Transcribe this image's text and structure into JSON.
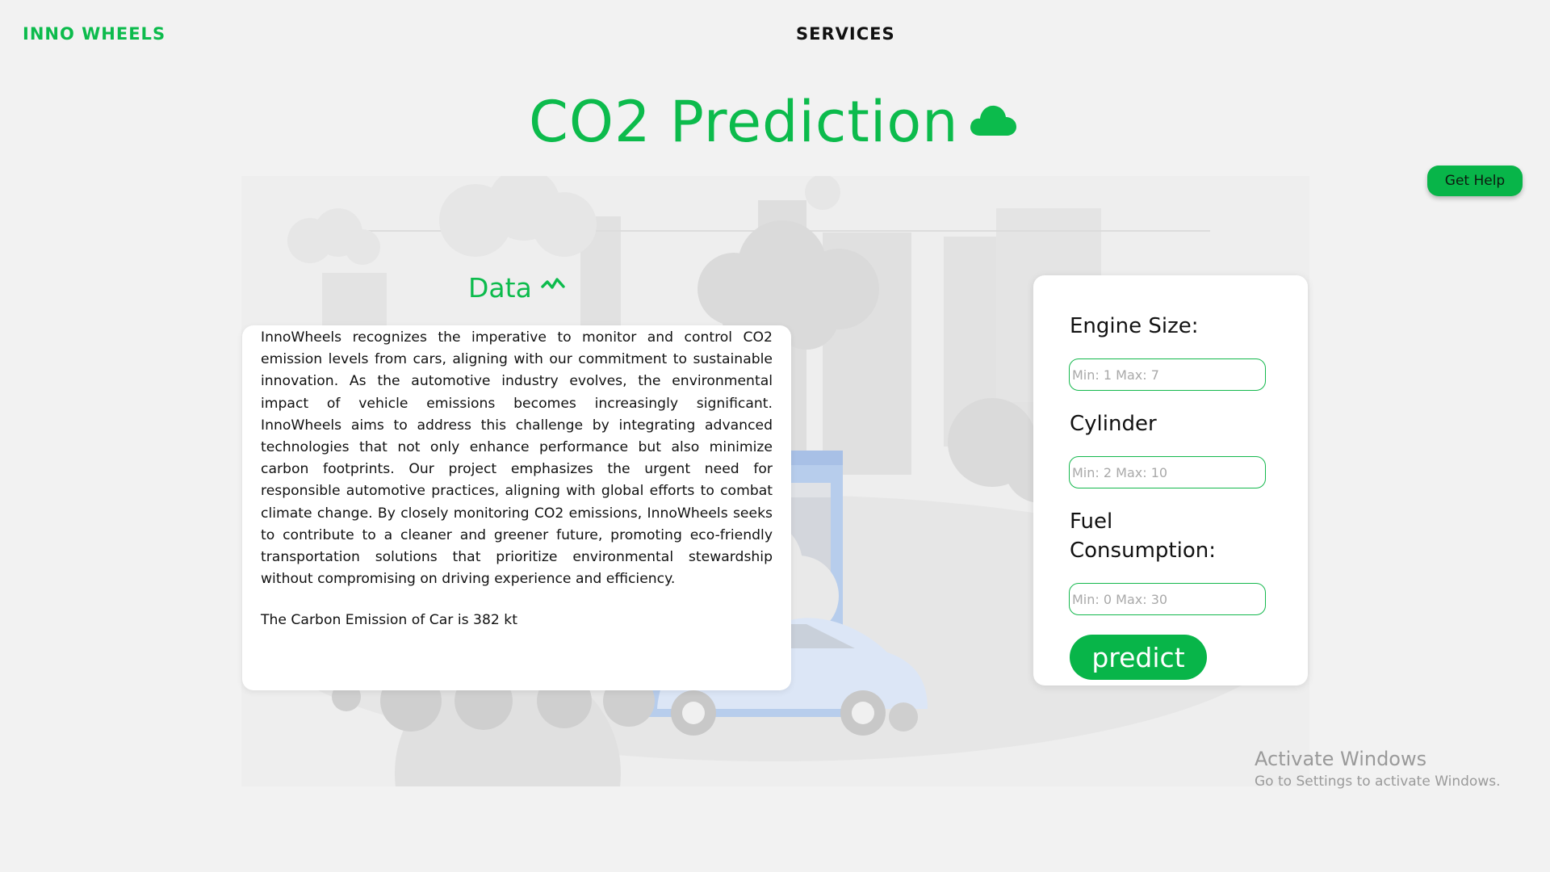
{
  "nav": {
    "brand": "INNO WHEELS",
    "services": "SERVICES"
  },
  "page": {
    "title": "CO2 Prediction",
    "title_icon": "cloud-icon"
  },
  "help": {
    "label": "Get Help"
  },
  "data_section": {
    "heading": "Data",
    "heading_icon": "activity-icon",
    "description": "InnoWheels recognizes the imperative to monitor and control CO2 emission levels from cars, aligning with our commitment to sustainable innovation. As the automotive industry evolves, the environmental impact of vehicle emissions becomes increasingly significant. InnoWheels aims to address this challenge by integrating advanced technologies that not only enhance performance but also minimize carbon footprints. Our project emphasizes the urgent need for responsible automotive practices, aligning with global efforts to combat climate change. By closely monitoring CO2 emissions, InnoWheels seeks to contribute to a cleaner and greener future, promoting eco-friendly transportation solutions that prioritize environmental stewardship without compromising on driving experience and efficiency.",
    "result": "The Carbon Emission of Car is 382 kt"
  },
  "form": {
    "engine_size": {
      "label": "Engine Size:",
      "placeholder": "Min: 1 Max: 7",
      "value": ""
    },
    "cylinder": {
      "label": "Cylinder",
      "placeholder": "Min: 2 Max: 10",
      "value": ""
    },
    "fuel": {
      "label_line1": "Fuel",
      "label_line2": "Consumption:",
      "placeholder": "Min: 0 Max: 30",
      "value": ""
    },
    "submit_label": "predict"
  },
  "os_watermark": {
    "line1": "Activate Windows",
    "line2": "Go to Settings to activate Windows."
  },
  "colors": {
    "accent": "#0cbb4c",
    "button": "#08b549",
    "background": "#f2f2f2"
  }
}
